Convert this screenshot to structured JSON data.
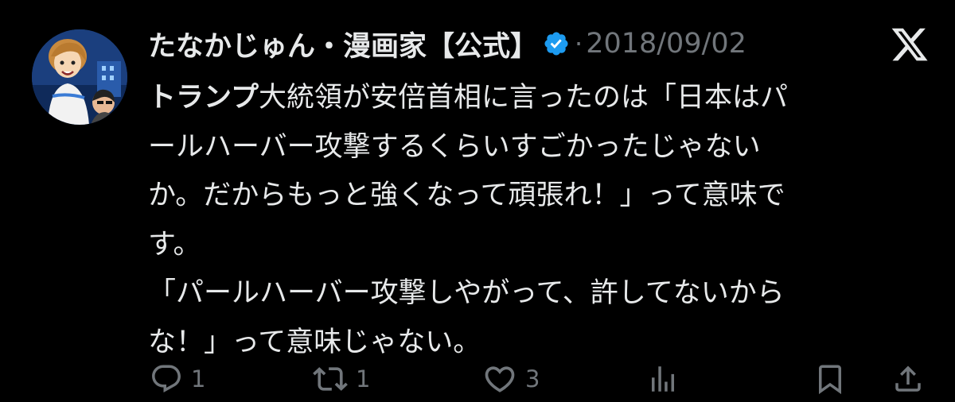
{
  "tweet": {
    "author_name": "たなかじゅん・漫画家【公式】",
    "separator": "·",
    "date": "2018/09/02",
    "body_bold_prefix": "トランプ",
    "body_text": "大統領が安倍首相に言ったのは「日本はパ\nールハーバー攻撃するくらいすごかったじゃない\nか。だからもっと強くなって頑張れ！」って意味で\nす。\n「パールハーバー攻撃しやがって、許してないから\nな！」って意味じゃない。",
    "avatar_icon": "avatar-illustration",
    "verified_icon": "verified-badge-icon",
    "platform_icon": "x-logo-icon"
  },
  "actions": {
    "reply": {
      "icon": "reply-icon",
      "count": "1"
    },
    "repost": {
      "icon": "repost-icon",
      "count": "1"
    },
    "like": {
      "icon": "heart-icon",
      "count": "3"
    },
    "views": {
      "icon": "views-icon"
    },
    "bookmark": {
      "icon": "bookmark-icon"
    },
    "share": {
      "icon": "share-icon"
    }
  },
  "colors": {
    "background": "#000000",
    "text": "#e7e9ea",
    "secondary": "#71767b",
    "verified": "#1d9bf0"
  }
}
